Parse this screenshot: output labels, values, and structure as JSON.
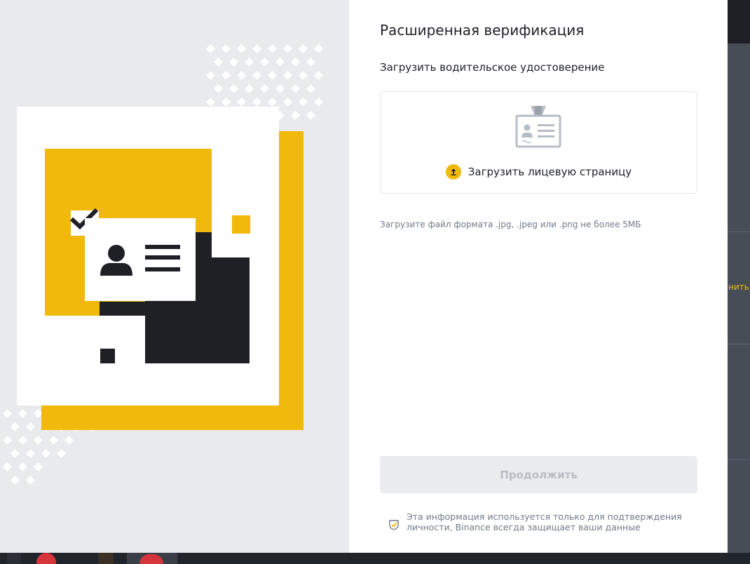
{
  "page": {
    "title": "Расширенная верификация",
    "subtitle": "Загрузить водительское удостоверение",
    "upload": {
      "label": "Загрузить лицевую страницу"
    },
    "hint": "Загрузите файл формата .jpg, .jpeg или .png не более 5МБ",
    "continue_label": "Продолжить",
    "privacy_note": "Эта информация используется только для подтверждения личности, Binance всегда защищает ваши данные"
  },
  "background": {
    "partial_text": "нить"
  },
  "colors": {
    "accent": "#f0b90b",
    "dark": "#1e2026",
    "muted_text": "#707a8a",
    "disabled_button_bg": "#eaecef",
    "disabled_button_text": "#b7bdc6"
  },
  "icons": {
    "upload": "upload-arrow-icon",
    "document": "id-card-icon",
    "privacy": "shield-check-icon"
  }
}
